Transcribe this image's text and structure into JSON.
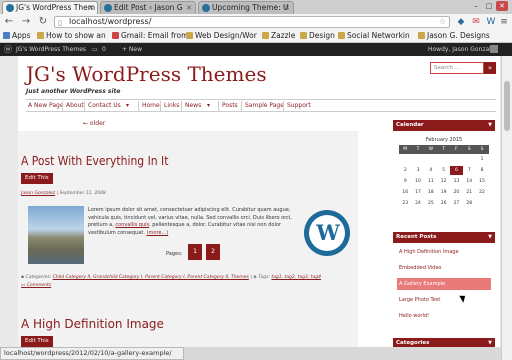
{
  "browser": {
    "tabs": [
      {
        "title": "JG's WordPress Them",
        "active": true
      },
      {
        "title": "Edit Post ‹ Jason G",
        "active": false
      },
      {
        "title": "Upcoming Theme: U",
        "active": false
      }
    ],
    "url": "localhost/wordpress/",
    "bookmarks": [
      "Apps",
      "How to show an",
      "Gmail: Email from",
      "Web Design/Wor",
      "Zazzle",
      "Design",
      "Social Networkin",
      "Jason G. Designs"
    ],
    "status_url": "localhost/wordpress/2012/02/10/a-gallery-example/"
  },
  "adminbar": {
    "site": "JG's WordPress Themes",
    "comments": "0",
    "new_label": "+ New",
    "howdy": "Howdy, Jason Gonzalez"
  },
  "site": {
    "title": "JG's WordPress Themes",
    "tagline": "Just another WordPress site",
    "search_placeholder": "Search ...",
    "search_btn": "»"
  },
  "menu": [
    "A New Page",
    "About",
    "Contact Us",
    "▾",
    "Home",
    "Links",
    "News",
    "▾",
    "Posts",
    "Sample Page",
    "Support"
  ],
  "pagenav": "← older",
  "post": {
    "title": "A Post With Everything In It",
    "edit": "Edit This",
    "author": "Jason Gonzalez",
    "date": "September 11, 2008",
    "body_a": "Lorem ipsum dolor sit amet, consectetuer adipiscing elit. Curabitur quam augue, vehicula quis, tincidunt vel, varius vitae, nulla. Sed convallis orci. Duis libero orci, pretium a, ",
    "body_link": "convallis quis",
    "body_b": ", pellentesque a, dolor. Curabitur vitae nisi non dolor vestibulum consequat. ",
    "more": "(more...)",
    "pages_label": "Pages:",
    "page1": "1",
    "page2": "2",
    "cats_label": "Categories:",
    "cats": "Child Category II, Grandchild Category I, Parent Category I, Parent Category II, Themes",
    "tags_label": "Tags:",
    "tags": "tag1, tag2, tag3, tag4",
    "comments": "Comments"
  },
  "post2": {
    "title": "A High Definition Image",
    "edit": "Edit This"
  },
  "sidebar": {
    "calendar_title": "Calendar",
    "calendar_caption": "February 2015",
    "days": [
      "M",
      "T",
      "W",
      "T",
      "F",
      "S",
      "S"
    ],
    "weeks": [
      [
        "",
        "",
        "",
        "",
        "",
        "",
        "1"
      ],
      [
        "2",
        "3",
        "4",
        "5",
        "6",
        "7",
        "8"
      ],
      [
        "9",
        "10",
        "11",
        "12",
        "13",
        "14",
        "15"
      ],
      [
        "16",
        "17",
        "18",
        "19",
        "20",
        "21",
        "22"
      ],
      [
        "23",
        "24",
        "25",
        "26",
        "27",
        "28",
        ""
      ]
    ],
    "recent_title": "Recent Posts",
    "recent": [
      "A High Definition Image",
      "Embedded Video",
      "A Gallery Example",
      "Large Photo Test",
      "Hello world!"
    ],
    "categories_title": "Categories"
  }
}
